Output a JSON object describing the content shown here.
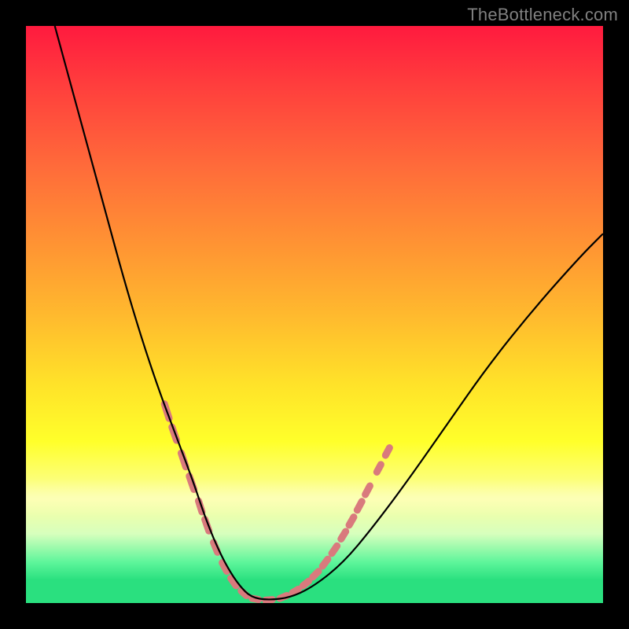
{
  "watermark": "TheBottleneck.com",
  "chart_data": {
    "type": "line",
    "title": "",
    "xlabel": "",
    "ylabel": "",
    "xlim": [
      0,
      100
    ],
    "ylim": [
      0,
      100
    ],
    "grid": false,
    "series": [
      {
        "name": "bottleneck-curve",
        "x": [
          5,
          8,
          11,
          14,
          17,
          20,
          23,
          26,
          29,
          31,
          33,
          35,
          37,
          39,
          42,
          46,
          50,
          55,
          60,
          66,
          73,
          80,
          88,
          96,
          100
        ],
        "y": [
          100,
          89,
          78,
          67,
          56,
          46,
          37,
          29,
          21,
          15,
          10,
          6,
          3,
          1,
          0.5,
          1,
          3,
          7,
          13,
          21,
          31,
          41,
          51,
          60,
          64
        ]
      }
    ],
    "highlight_segments": {
      "name": "pink-dashes",
      "color": "#d97a7d",
      "points": [
        {
          "x1": 24.0,
          "y1": 34.5,
          "x2": 24.8,
          "y2": 32.0
        },
        {
          "x1": 25.3,
          "y1": 30.5,
          "x2": 26.1,
          "y2": 28.2
        },
        {
          "x1": 26.9,
          "y1": 26.0,
          "x2": 27.7,
          "y2": 23.6
        },
        {
          "x1": 28.3,
          "y1": 22.0,
          "x2": 29.1,
          "y2": 19.7
        },
        {
          "x1": 29.9,
          "y1": 17.7,
          "x2": 30.5,
          "y2": 15.8
        },
        {
          "x1": 31.0,
          "y1": 14.5,
          "x2": 31.7,
          "y2": 12.5
        },
        {
          "x1": 32.5,
          "y1": 10.5,
          "x2": 33.2,
          "y2": 8.8
        },
        {
          "x1": 34.0,
          "y1": 7.0,
          "x2": 34.8,
          "y2": 5.5
        },
        {
          "x1": 35.5,
          "y1": 4.3,
          "x2": 36.4,
          "y2": 3.0
        },
        {
          "x1": 37.3,
          "y1": 2.1,
          "x2": 38.2,
          "y2": 1.3
        },
        {
          "x1": 39.2,
          "y1": 0.8,
          "x2": 40.3,
          "y2": 0.6
        },
        {
          "x1": 41.5,
          "y1": 0.5,
          "x2": 42.7,
          "y2": 0.6
        },
        {
          "x1": 44.0,
          "y1": 0.8,
          "x2": 45.2,
          "y2": 1.3
        },
        {
          "x1": 46.2,
          "y1": 1.8,
          "x2": 47.2,
          "y2": 2.4
        },
        {
          "x1": 48.0,
          "y1": 3.0,
          "x2": 49.0,
          "y2": 3.8
        },
        {
          "x1": 49.7,
          "y1": 4.5,
          "x2": 50.7,
          "y2": 5.5
        },
        {
          "x1": 51.4,
          "y1": 6.4,
          "x2": 52.3,
          "y2": 7.6
        },
        {
          "x1": 53.0,
          "y1": 8.6,
          "x2": 53.9,
          "y2": 9.9
        },
        {
          "x1": 54.6,
          "y1": 11.1,
          "x2": 55.4,
          "y2": 12.4
        },
        {
          "x1": 56.0,
          "y1": 13.5,
          "x2": 56.8,
          "y2": 14.9
        },
        {
          "x1": 57.4,
          "y1": 16.1,
          "x2": 58.2,
          "y2": 17.6
        },
        {
          "x1": 58.8,
          "y1": 18.8,
          "x2": 59.6,
          "y2": 20.3
        },
        {
          "x1": 60.8,
          "y1": 22.7,
          "x2": 61.5,
          "y2": 24.0
        },
        {
          "x1": 62.3,
          "y1": 25.6,
          "x2": 63.0,
          "y2": 26.9
        }
      ]
    },
    "background_gradient": {
      "direction": "vertical",
      "stops": [
        {
          "pos": 0.0,
          "color": "#ff1a3e"
        },
        {
          "pos": 0.1,
          "color": "#ff3d3d"
        },
        {
          "pos": 0.24,
          "color": "#ff6a3a"
        },
        {
          "pos": 0.38,
          "color": "#ff9433"
        },
        {
          "pos": 0.5,
          "color": "#ffb92e"
        },
        {
          "pos": 0.62,
          "color": "#ffe229"
        },
        {
          "pos": 0.72,
          "color": "#ffff2a"
        },
        {
          "pos": 0.82,
          "color": "#fbffa0"
        },
        {
          "pos": 0.88,
          "color": "#d7ffbd"
        },
        {
          "pos": 0.93,
          "color": "#5cf59a"
        },
        {
          "pos": 0.96,
          "color": "#2ae07f"
        },
        {
          "pos": 1.0,
          "color": "#2ae07f"
        }
      ]
    }
  }
}
